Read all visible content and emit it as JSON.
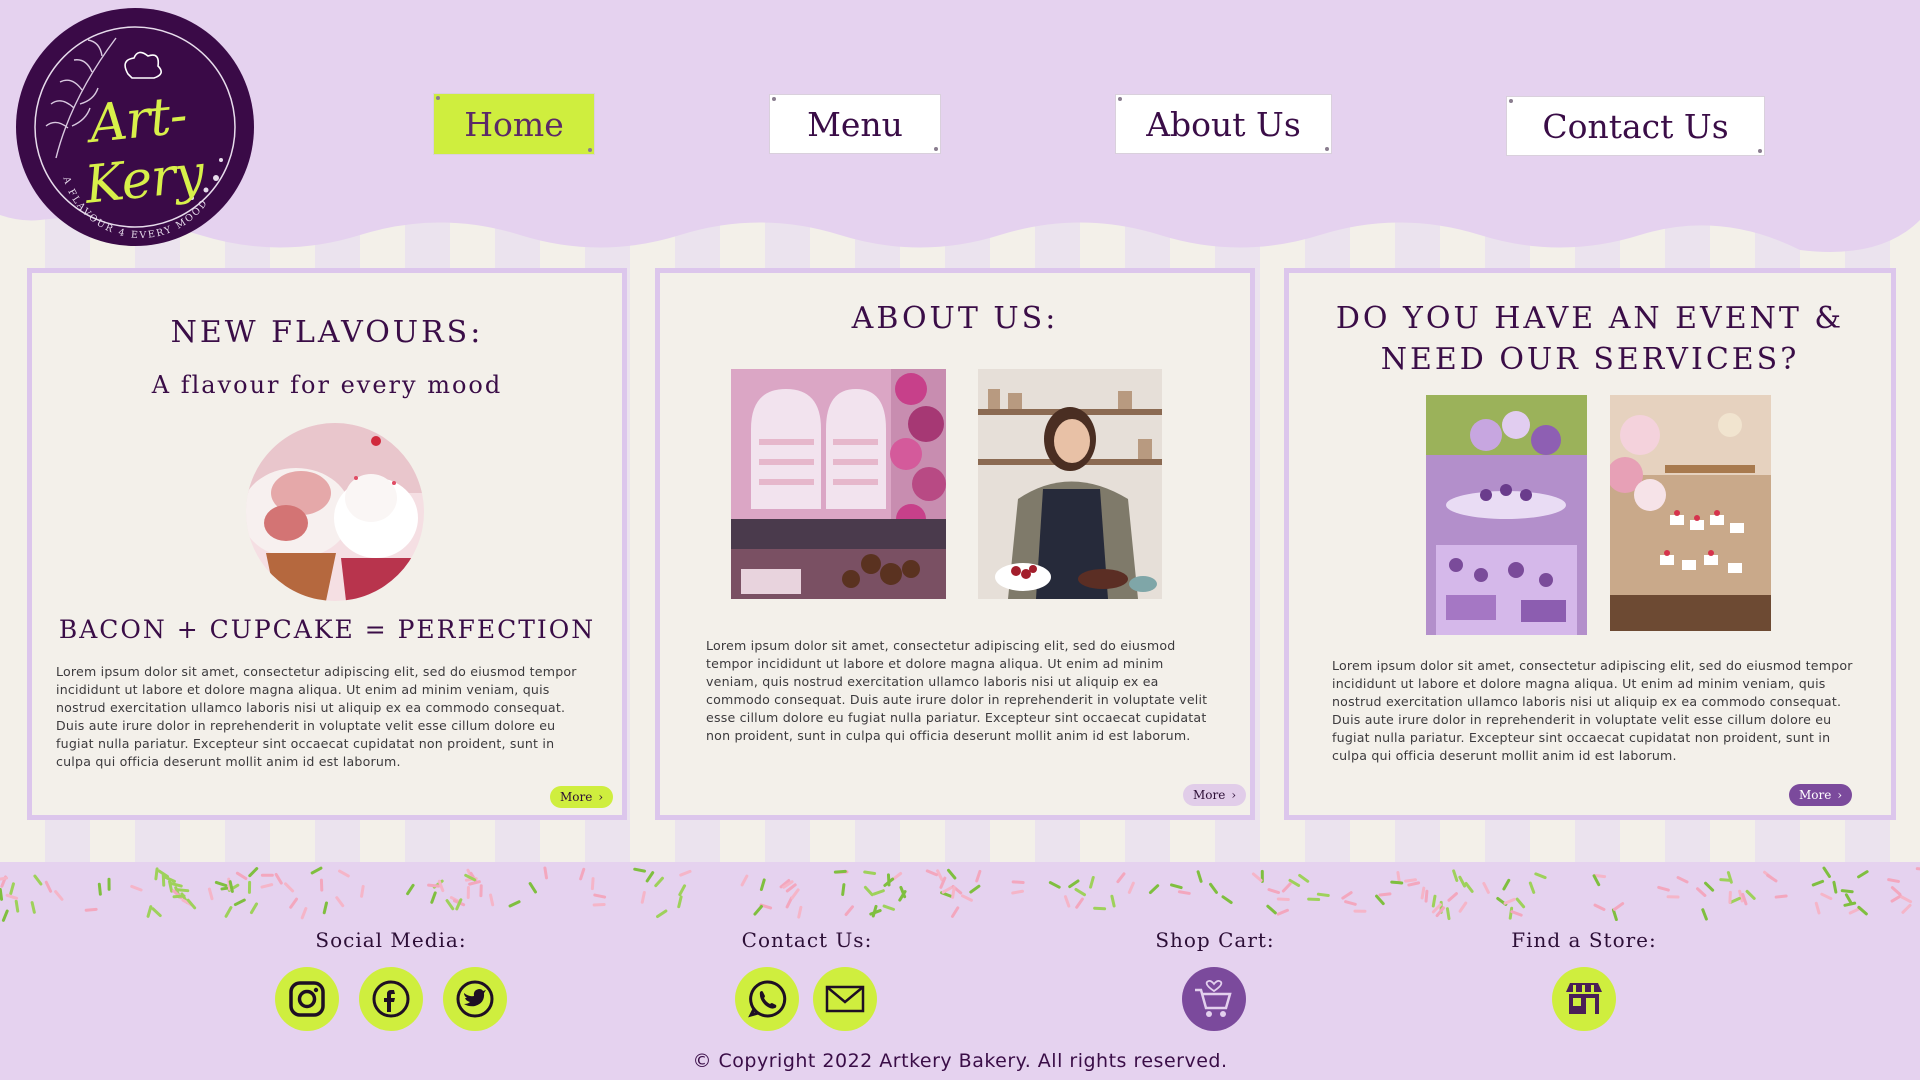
{
  "brand": {
    "logo_name": "Art-Kery",
    "logo_tagline": "A FLAVOUR 4 EVERY MOOD"
  },
  "nav": {
    "items": [
      {
        "label": "Home",
        "active": true
      },
      {
        "label": "Menu",
        "active": false
      },
      {
        "label": "About Us",
        "active": false
      },
      {
        "label": "Contact Us",
        "active": false
      }
    ]
  },
  "panels": {
    "flavours": {
      "title": "NEW FLAVOURS:",
      "subtitle": "A flavour for every mood",
      "heading": "BACON + CUPCAKE = PERFECTION",
      "body": "Lorem ipsum dolor sit amet, consectetur adipiscing elit, sed do eiusmod tempor incididunt ut labore et dolore magna aliqua. Ut enim ad minim veniam, quis nostrud exercitation ullamco laboris nisi ut aliquip ex ea commodo consequat. Duis aute irure dolor in reprehenderit in voluptate velit esse cillum dolore eu fugiat nulla pariatur. Excepteur sint occaecat cupidatat non proident, sunt in culpa qui officia deserunt mollit anim id est laborum.",
      "more_label": "More"
    },
    "about": {
      "title": "ABOUT US:",
      "body": "Lorem ipsum dolor sit amet, consectetur adipiscing elit, sed do eiusmod tempor incididunt ut labore et dolore magna aliqua. Ut enim ad minim veniam, quis nostrud exercitation ullamco laboris nisi ut aliquip ex ea commodo consequat. Duis aute irure dolor in reprehenderit in voluptate velit esse cillum dolore eu fugiat nulla pariatur. Excepteur sint occaecat cupidatat non proident, sunt in culpa qui officia deserunt mollit anim id est laborum.",
      "more_label": "More"
    },
    "events": {
      "title_line1": "DO YOU HAVE AN EVENT &",
      "title_line2": "NEED OUR SERVICES?",
      "body": "Lorem ipsum dolor sit amet, consectetur adipiscing elit, sed do eiusmod tempor incididunt ut labore et dolore magna aliqua. Ut enim ad minim veniam, quis nostrud exercitation ullamco laboris nisi ut aliquip ex ea commodo consequat. Duis aute irure dolor in reprehenderit in voluptate velit esse cillum dolore eu fugiat nulla pariatur. Excepteur sint occaecat cupidatat non proident, sunt in culpa qui officia deserunt mollit anim id est laborum.",
      "more_label": "More"
    }
  },
  "footer": {
    "social_label": "Social Media:",
    "contact_label": "Contact Us:",
    "cart_label": "Shop Cart:",
    "store_label": "Find a Store:",
    "social_icons": [
      "instagram-icon",
      "facebook-icon",
      "twitter-icon"
    ],
    "contact_icons": [
      "whatsapp-icon",
      "mail-icon"
    ],
    "cart_icon": "shopping-cart-icon",
    "store_icon": "store-icon",
    "copyright": "© Copyright 2022 Artkery Bakery. All rights reserved."
  },
  "colors": {
    "background": "#e5d2ef",
    "accent_lime": "#cfee3e",
    "accent_purple": "#7b4a9c",
    "deep_purple": "#3a0a47",
    "panel": "#f3f0ea"
  }
}
